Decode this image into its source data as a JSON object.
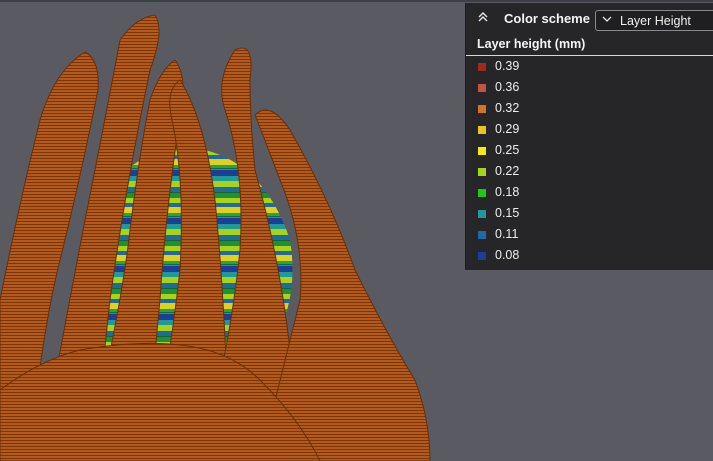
{
  "viewport": {
    "object_color": "#b35a1a",
    "background_color": "#5a5b62"
  },
  "legend": {
    "collapse_icon": "double-chevron-up-icon",
    "scheme_label": "Color scheme",
    "scheme_value": "Layer Height",
    "select_icon": "chevron-down-icon",
    "title": "Layer height (mm)",
    "items": [
      {
        "label": "0.39",
        "color": "#a0281c"
      },
      {
        "label": "0.36",
        "color": "#c65240"
      },
      {
        "label": "0.32",
        "color": "#d2732c"
      },
      {
        "label": "0.29",
        "color": "#e9c21a"
      },
      {
        "label": "0.25",
        "color": "#f2ea10"
      },
      {
        "label": "0.22",
        "color": "#a6d418"
      },
      {
        "label": "0.18",
        "color": "#22c422"
      },
      {
        "label": "0.15",
        "color": "#21999a"
      },
      {
        "label": "0.11",
        "color": "#1d6aa6"
      },
      {
        "label": "0.08",
        "color": "#1b3f96"
      }
    ]
  }
}
